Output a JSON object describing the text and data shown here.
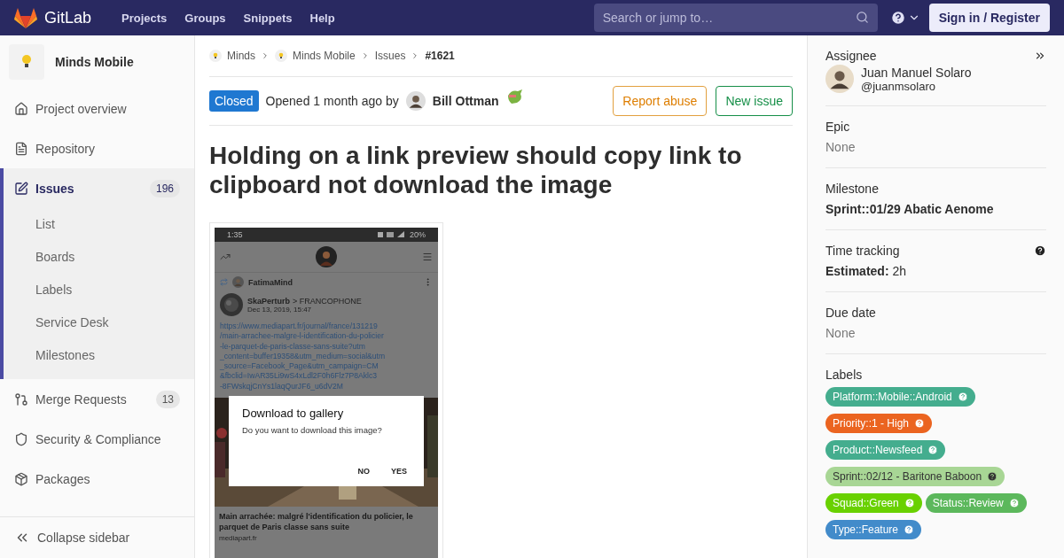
{
  "header": {
    "logo_text": "GitLab",
    "nav": [
      "Projects",
      "Groups",
      "Snippets",
      "Help"
    ],
    "search": {
      "placeholder": "Search or jump to…"
    },
    "sign_in": "Sign in / Register"
  },
  "sidebar": {
    "project": "Minds Mobile",
    "items": [
      {
        "label": "Project overview",
        "kind": "home",
        "selected": false
      },
      {
        "label": "Repository",
        "kind": "file",
        "selected": false
      },
      {
        "label": "Issues",
        "kind": "issues",
        "count": "196",
        "selected": true,
        "children": [
          {
            "label": "List"
          },
          {
            "label": "Boards"
          },
          {
            "label": "Labels"
          },
          {
            "label": "Service Desk"
          },
          {
            "label": "Milestones"
          }
        ]
      },
      {
        "label": "Merge Requests",
        "kind": "merge",
        "count": "13",
        "selected": false
      },
      {
        "label": "Security & Compliance",
        "kind": "shield",
        "selected": false
      },
      {
        "label": "Packages",
        "kind": "package",
        "selected": false
      }
    ],
    "collapse": "Collapse sidebar"
  },
  "breadcrumbs": [
    {
      "label": "Minds",
      "kind": "project"
    },
    {
      "label": "Minds Mobile",
      "kind": "project"
    },
    {
      "label": "Issues",
      "kind": "link"
    },
    {
      "label": "#1621",
      "kind": "current"
    }
  ],
  "issue": {
    "status": "Closed",
    "opened": "Opened 1 month ago by",
    "author": "Bill Ottman",
    "buttons": [
      {
        "label": "Report abuse",
        "kind": "warning"
      },
      {
        "label": "New issue",
        "kind": "success"
      }
    ],
    "title": "Holding on a link preview should copy link to clipboard not download the image"
  },
  "attachment": {
    "time": "1:35",
    "battery": "20%",
    "repost_user": "FatimaMind",
    "author": "SkaPerturb",
    "channel": "> FRANCOPHONE",
    "date": "Dec 13, 2019, 15:47",
    "link_lines": [
      "https://www.mediapart.fr/journal/france/131219",
      "/main-arrachee-malgre-l-identification-du-policier",
      "-le-parquet-de-paris-classe-sans-suite?utm",
      "_content=buffer19358&utm_medium=social&utm",
      "_source=Facebook_Page&utm_campaign=CM",
      "&fbclid=IwAR35Li9wS4xLdl2F0h6Flz7P8Aklc3",
      "-8FWskqjCnYs1laqQurJF6_u6dV2M"
    ],
    "dialog": {
      "title": "Download to gallery",
      "message": "Do you want to download this image?",
      "buttons": [
        "NO",
        "YES"
      ]
    },
    "preview_title": "Main arrachée: malgré l'identification du policier, le parquet de Paris classe sans suite",
    "preview_source": "mediapart.fr"
  },
  "details": [
    {
      "kind": "assignee",
      "heading": "Assignee",
      "name": "Juan Manuel Solaro",
      "handle": "@juanmsolaro"
    },
    {
      "kind": "muted",
      "heading": "Epic",
      "value": "None"
    },
    {
      "kind": "bold",
      "heading": "Milestone",
      "value": "Sprint::01/29 Abatic Aenome"
    },
    {
      "kind": "time",
      "heading": "Time tracking",
      "term": "Estimated:",
      "value": "2h"
    },
    {
      "kind": "muted",
      "heading": "Due date",
      "value": "None"
    },
    {
      "kind": "labels",
      "heading": "Labels",
      "labels": [
        {
          "label": "Platform::Mobile::Android",
          "color": "#44ad8e"
        },
        {
          "label": "Priority::1 - High",
          "color": "#eb6420"
        },
        {
          "label": "Product::Newsfeed",
          "color": "#44ad8e"
        },
        {
          "label": "Sprint::02/12 - Baritone Baboon",
          "color": "#a8d695"
        },
        {
          "label": "Squad::Green",
          "color": "#69d100"
        },
        {
          "label": "Status::Review",
          "color": "#5cb85c"
        },
        {
          "label": "Type::Feature",
          "color": "#428bca"
        }
      ]
    }
  ]
}
